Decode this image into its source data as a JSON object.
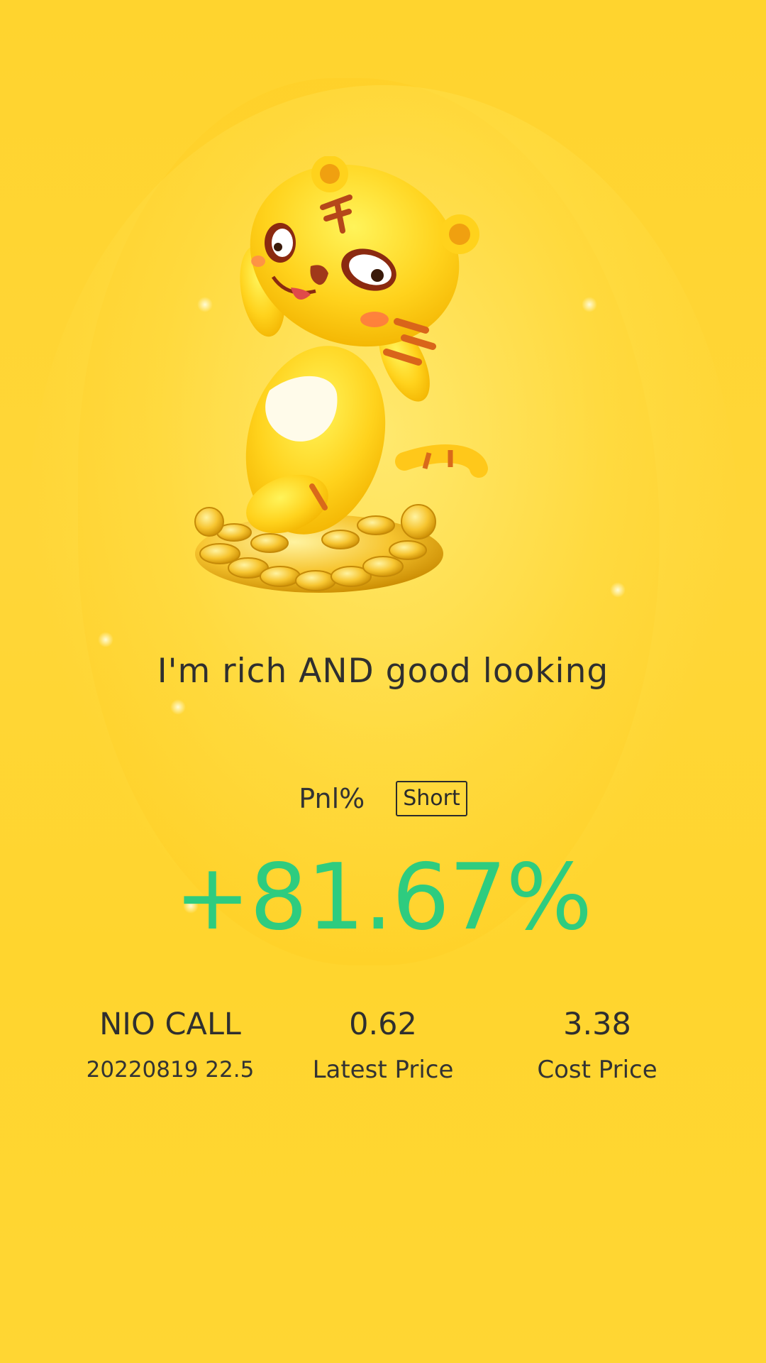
{
  "tagline": "I'm rich AND good looking",
  "pnl": {
    "label": "Pnl%",
    "direction": "Short",
    "value": "+81.67%"
  },
  "stats": {
    "instrument": {
      "name": "NIO CALL",
      "detail": "20220819 22.5"
    },
    "latest": {
      "value": "0.62",
      "label": "Latest Price"
    },
    "cost": {
      "value": "3.38",
      "label": "Cost Price"
    }
  },
  "colors": {
    "background": "#ffd42e",
    "gain": "#2ecc7f",
    "text": "#2f2f2f"
  },
  "mascot": {
    "icon": "tiger-mascot-on-coins"
  }
}
